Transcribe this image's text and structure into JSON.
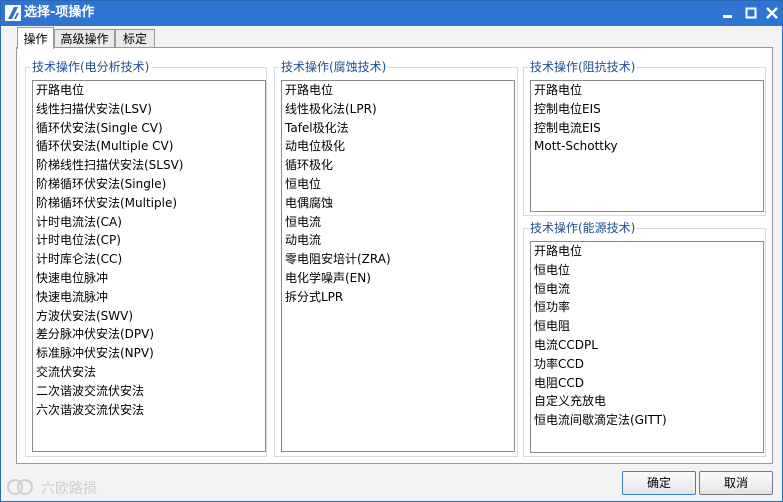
{
  "window": {
    "title": "选择-项操作"
  },
  "tabs": [
    {
      "label": "操作"
    },
    {
      "label": "高级操作"
    },
    {
      "label": "标定"
    }
  ],
  "groups": {
    "electroanalysis": {
      "title": "技术操作(电分析技术)",
      "items": [
        "开路电位",
        "线性扫描伏安法(LSV)",
        "循环伏安法(Single CV)",
        "循环伏安法(Multiple CV)",
        "阶梯线性扫描伏安法(SLSV)",
        "阶梯循环伏安法(Single)",
        "阶梯循环伏安法(Multiple)",
        "计时电流法(CA)",
        "计时电位法(CP)",
        "计时库仑法(CC)",
        "快速电位脉冲",
        "快速电流脉冲",
        "方波伏安法(SWV)",
        "差分脉冲伏安法(DPV)",
        "标准脉冲伏安法(NPV)",
        "交流伏安法",
        "二次谐波交流伏安法",
        "六次谐波交流伏安法"
      ]
    },
    "corrosion": {
      "title": "技术操作(腐蚀技术)",
      "items": [
        "开路电位",
        "线性极化法(LPR)",
        "Tafel极化法",
        "动电位极化",
        "循环极化",
        "恒电位",
        "电偶腐蚀",
        "恒电流",
        "动电流",
        "零电阻安培计(ZRA)",
        "电化学噪声(EN)",
        "拆分式LPR"
      ]
    },
    "impedance": {
      "title": "技术操作(阻抗技术)",
      "items": [
        "开路电位",
        "控制电位EIS",
        "控制电流EIS",
        "Mott-Schottky"
      ]
    },
    "energy": {
      "title": "技术操作(能源技术)",
      "items": [
        "开路电位",
        "恒电位",
        "恒电流",
        "恒功率",
        "恒电阻",
        "电流CCDPL",
        "功率CCD",
        "电阻CCD",
        "自定义充放电",
        "恒电流间歇滴定法(GITT)"
      ]
    }
  },
  "buttons": {
    "ok": "确定",
    "cancel": "取消"
  },
  "watermark": {
    "text": "六欧路损"
  },
  "colors": {
    "titlebar": "#2f74d0",
    "group_title": "#1f4f8f"
  }
}
